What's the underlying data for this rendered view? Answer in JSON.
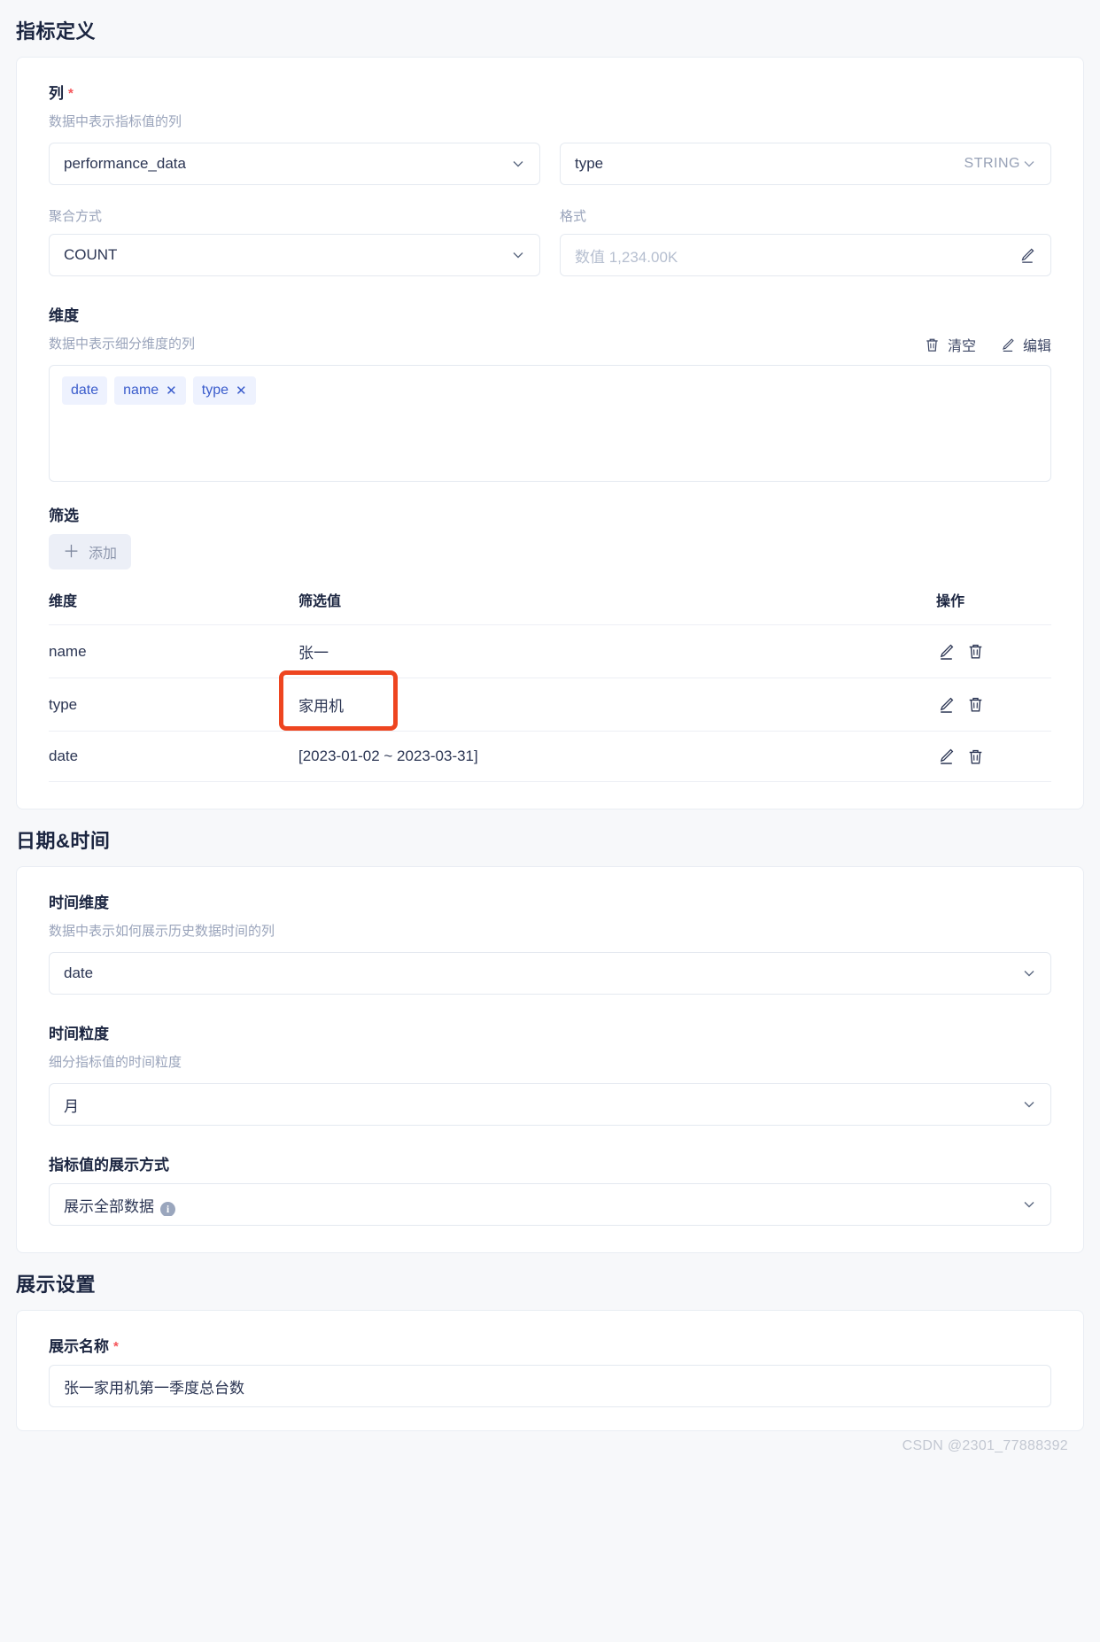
{
  "sections": {
    "metric_definition": {
      "title": "指标定义",
      "column": {
        "label": "列",
        "required_mark": "*",
        "hint": "数据中表示指标值的列",
        "table_select": "performance_data",
        "field_select": "type",
        "field_type": "STRING"
      },
      "aggregation": {
        "label": "聚合方式",
        "value": "COUNT"
      },
      "format": {
        "label": "格式",
        "placeholder": "数值 1,234.00K",
        "value": ""
      },
      "dimension": {
        "label": "维度",
        "hint": "数据中表示细分维度的列",
        "clear_label": "清空",
        "edit_label": "编辑",
        "tags": [
          {
            "text": "date",
            "removable": false
          },
          {
            "text": "name",
            "removable": true
          },
          {
            "text": "type",
            "removable": true
          }
        ],
        "remove_glyph": "✕"
      },
      "filter": {
        "label": "筛选",
        "add_label": "添加",
        "add_glyph": "＋",
        "headers": [
          "维度",
          "筛选值",
          "操作"
        ],
        "rows": [
          {
            "dimension": "name",
            "value": "张一",
            "highlighted": false
          },
          {
            "dimension": "type",
            "value": "家用机",
            "highlighted": true
          },
          {
            "dimension": "date",
            "value": "[2023-01-02 ~ 2023-03-31]",
            "highlighted": false
          }
        ]
      }
    },
    "date_time": {
      "title": "日期&时间",
      "time_dimension": {
        "label": "时间维度",
        "hint": "数据中表示如何展示历史数据时间的列",
        "value": "date"
      },
      "time_granularity": {
        "label": "时间粒度",
        "hint": "细分指标值的时间粒度",
        "value": "月"
      },
      "display_mode": {
        "label": "指标值的展示方式",
        "value": "展示全部数据",
        "info_glyph": "i"
      }
    },
    "display_settings": {
      "title": "展示设置",
      "display_name": {
        "label": "展示名称",
        "required_mark": "*",
        "value": "张一家用机第一季度总台数"
      }
    }
  },
  "watermark": "CSDN @2301_77888392",
  "colors": {
    "highlight_box": "#ee4520",
    "tag_text": "#3a5ccc",
    "tag_bg": "#eef2fe",
    "required": "#f5555a"
  }
}
